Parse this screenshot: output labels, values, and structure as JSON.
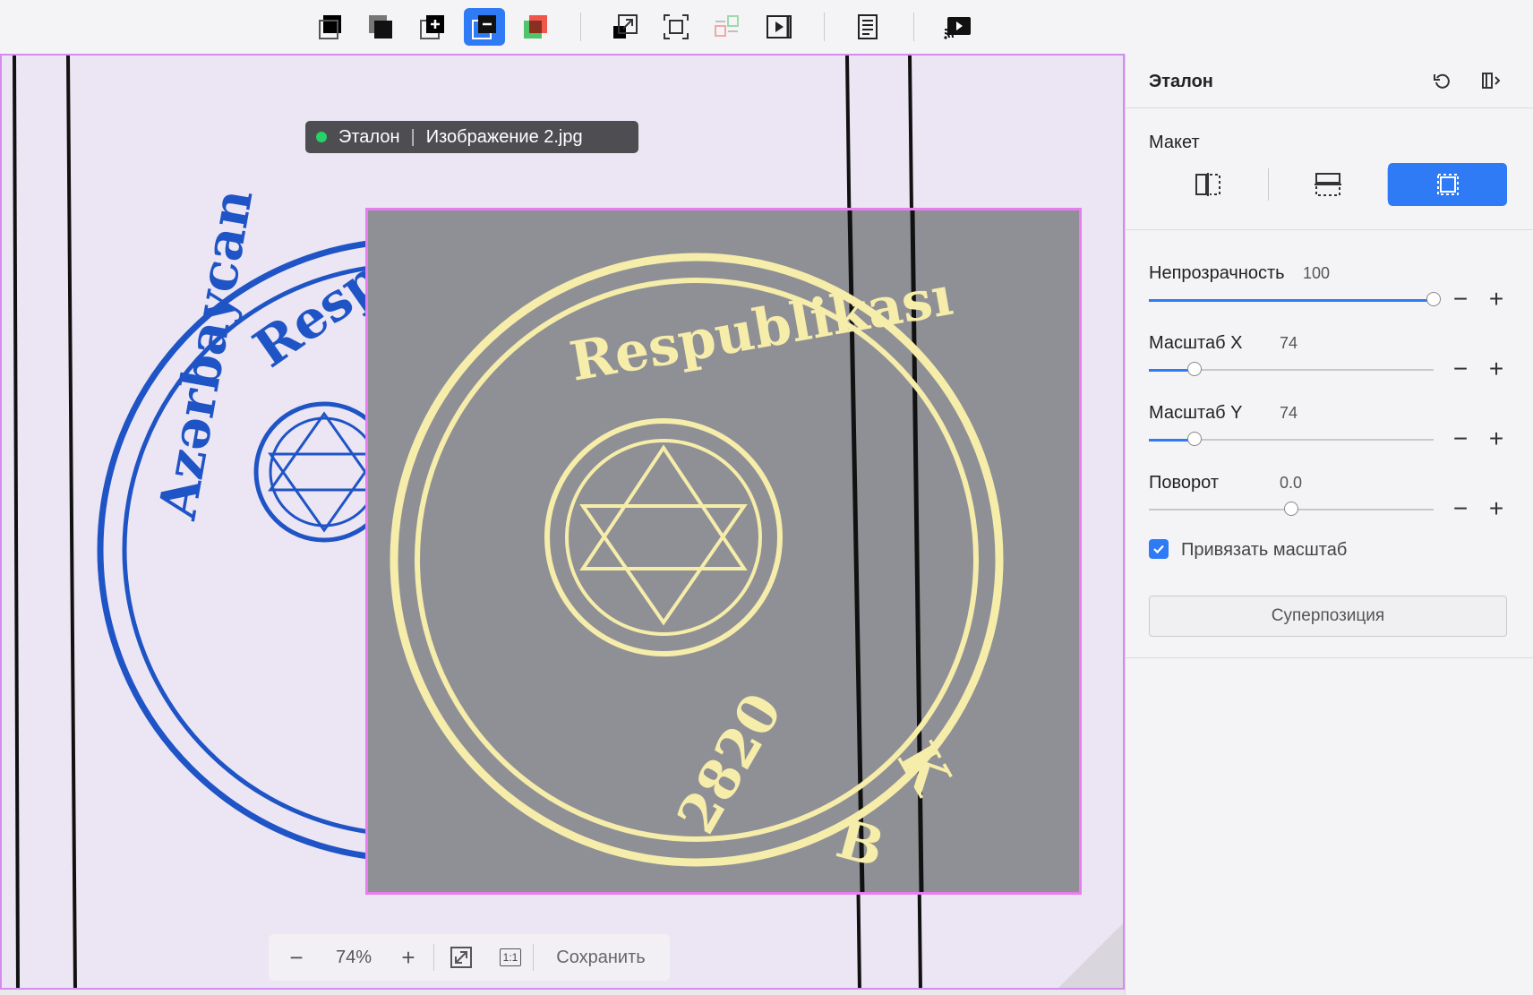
{
  "toolbar": {
    "buttons": [
      {
        "name": "fill-black-tool",
        "active": false
      },
      {
        "name": "fill-gray-tool",
        "active": false
      },
      {
        "name": "add-layer-tool",
        "active": false
      },
      {
        "name": "subtract-layer-tool",
        "active": true
      },
      {
        "name": "color-diff-tool",
        "active": false
      },
      {
        "name": "transform-tool",
        "active": false
      },
      {
        "name": "crop-tool",
        "active": false
      },
      {
        "name": "align-tool",
        "active": false
      },
      {
        "name": "play-tool",
        "active": false
      },
      {
        "name": "report-tool",
        "active": false
      },
      {
        "name": "cast-tool",
        "active": false
      }
    ]
  },
  "canvas": {
    "info_label": "Эталон",
    "info_file": "Изображение 2.jpg"
  },
  "zoombar": {
    "minus": "−",
    "zoom": "74%",
    "plus": "+",
    "one_to_one": "1:1",
    "save": "Сохранить"
  },
  "panel": {
    "title": "Эталон",
    "layout_label": "Макет",
    "layout_active": "overlay",
    "opacity": {
      "label": "Непрозрачность",
      "value": "100",
      "fraction": 1.0
    },
    "scale_x": {
      "label": "Масштаб X",
      "value": "74",
      "fraction": 0.16
    },
    "scale_y": {
      "label": "Масштаб Y",
      "value": "74",
      "fraction": 0.16
    },
    "rotation": {
      "label": "Поворот",
      "value": "0.0",
      "fraction": 0.5
    },
    "lock_scale": {
      "label": "Привязать масштаб",
      "checked": true
    },
    "superposition_button": "Суперпозиция"
  },
  "colors": {
    "accent": "#2f7bf5",
    "overlay_border": "#e87df0",
    "stamp_blue": "#1f54c6",
    "stamp_yellow": "#f6edaa"
  }
}
